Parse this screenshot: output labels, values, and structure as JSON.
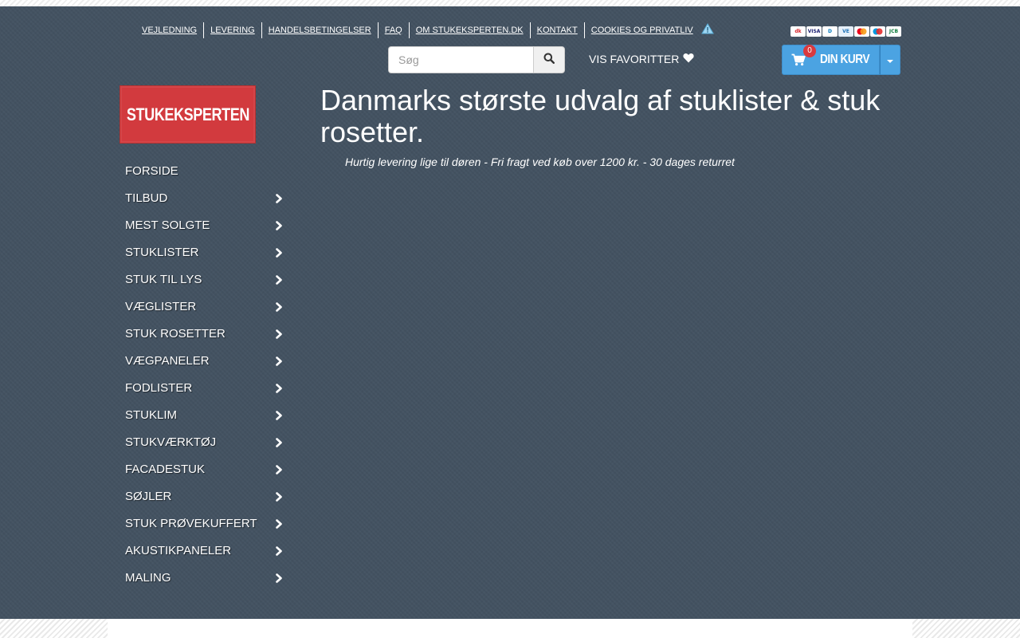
{
  "top_links": [
    {
      "label": "VEJLEDNING"
    },
    {
      "label": "LEVERING"
    },
    {
      "label": "HANDELSBETINGELSER"
    },
    {
      "label": "FAQ"
    },
    {
      "label": "OM STUKEKSPERTEN.DK"
    },
    {
      "label": "KONTAKT"
    },
    {
      "label": "COOKIES OG PRIVATLIV"
    }
  ],
  "payment_cards": [
    {
      "name": "dankort-icon",
      "color": "#d8232a"
    },
    {
      "name": "visa-icon",
      "color": "#1a1f71"
    },
    {
      "name": "diners-icon",
      "color": "#0079be"
    },
    {
      "name": "visa-electron-icon",
      "color": "#1a6fb5"
    },
    {
      "name": "mastercard-icon",
      "color": "#eb001b"
    },
    {
      "name": "maestro-icon",
      "color": "#0099df"
    },
    {
      "name": "jcb-icon",
      "color": "#0b7a3a"
    }
  ],
  "search": {
    "placeholder": "Søg"
  },
  "favorites": {
    "label": "VIS FAVORITTER"
  },
  "cart": {
    "count": "0",
    "label": "DIN KURV",
    "color": "#4ba3e2",
    "badge_color": "#d9393e"
  },
  "logo": {
    "text": "STUKEKSPERTEN",
    "color": "#d23a3e"
  },
  "nav": {
    "items": [
      {
        "label": "FORSIDE",
        "has_children": false
      },
      {
        "label": "TILBUD",
        "has_children": true
      },
      {
        "label": "MEST SOLGTE",
        "has_children": true
      },
      {
        "label": "STUKLISTER",
        "has_children": true
      },
      {
        "label": "STUK TIL LYS",
        "has_children": true
      },
      {
        "label": "VÆGLISTER",
        "has_children": true
      },
      {
        "label": "STUK ROSETTER",
        "has_children": true
      },
      {
        "label": "VÆGPANELER",
        "has_children": true
      },
      {
        "label": "FODLISTER",
        "has_children": true
      },
      {
        "label": "STUKLIM",
        "has_children": true
      },
      {
        "label": "STUKVÆRKTØJ",
        "has_children": true
      },
      {
        "label": "FACADESTUK",
        "has_children": true
      },
      {
        "label": "SØJLER",
        "has_children": true
      },
      {
        "label": "STUK PRØVEKUFFERT",
        "has_children": true
      },
      {
        "label": "AKUSTIKPANELER",
        "has_children": true
      },
      {
        "label": "MALING",
        "has_children": true
      }
    ]
  },
  "main": {
    "headline": "Danmarks største udvalg af stuklister & stuk rosetter.",
    "subline": "Hurtig levering lige til døren - Fri fragt ved køb over 1200 kr. - 30 dages returret"
  },
  "theme": {
    "background": "#435261"
  }
}
